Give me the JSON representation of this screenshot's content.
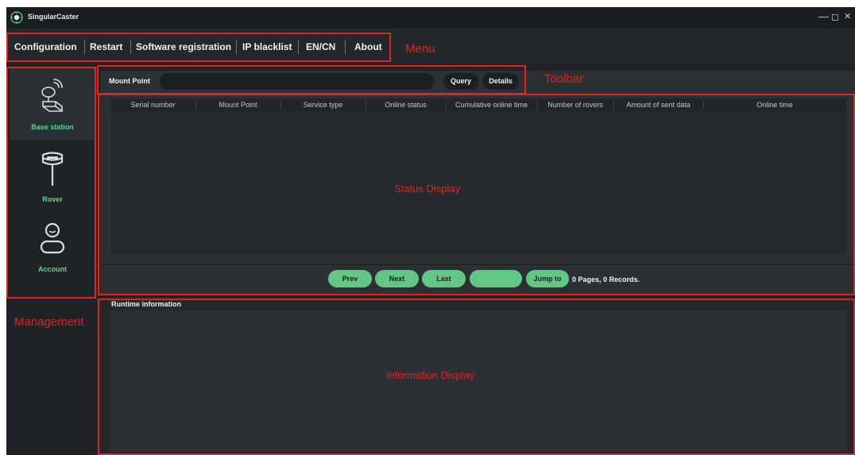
{
  "titlebar": {
    "title": "SingularCaster",
    "minimize": "—",
    "maximize": "◻",
    "close": "✕"
  },
  "menu": {
    "items": [
      {
        "label": "Configuration"
      },
      {
        "label": "Restart"
      },
      {
        "label": "Software registration"
      },
      {
        "label": "IP blacklist"
      },
      {
        "label": "EN/CN"
      },
      {
        "label": "About"
      }
    ]
  },
  "sidebar": {
    "items": [
      {
        "label": "Base station",
        "icon": "base-station-icon",
        "active": true
      },
      {
        "label": "Rover",
        "icon": "rover-icon",
        "active": false
      },
      {
        "label": "Account",
        "icon": "account-icon",
        "active": false
      }
    ]
  },
  "toolbar": {
    "label": "Mount Point",
    "input_value": "",
    "query_label": "Query",
    "details_label": "Details"
  },
  "table": {
    "columns": [
      "Serial number",
      "Mount Point",
      "Service type",
      "Online status",
      "Cumulative online time",
      "Number of rovers",
      "Amount of sent data",
      "Online time"
    ],
    "rows": []
  },
  "pager": {
    "prev": "Prev",
    "next": "Next",
    "last": "Last",
    "page_input": "",
    "jump": "Jump to",
    "info": "0 Pages, 0 Records."
  },
  "runtime": {
    "title": "Runtime information"
  },
  "annotations": {
    "menu": "Menu",
    "toolbar": "Toolbar",
    "status": "Status Display",
    "management": "Management",
    "information": "Information Display"
  },
  "colors": {
    "accent": "#62c684",
    "annotation": "#e2231a",
    "background": "#1f2327"
  }
}
